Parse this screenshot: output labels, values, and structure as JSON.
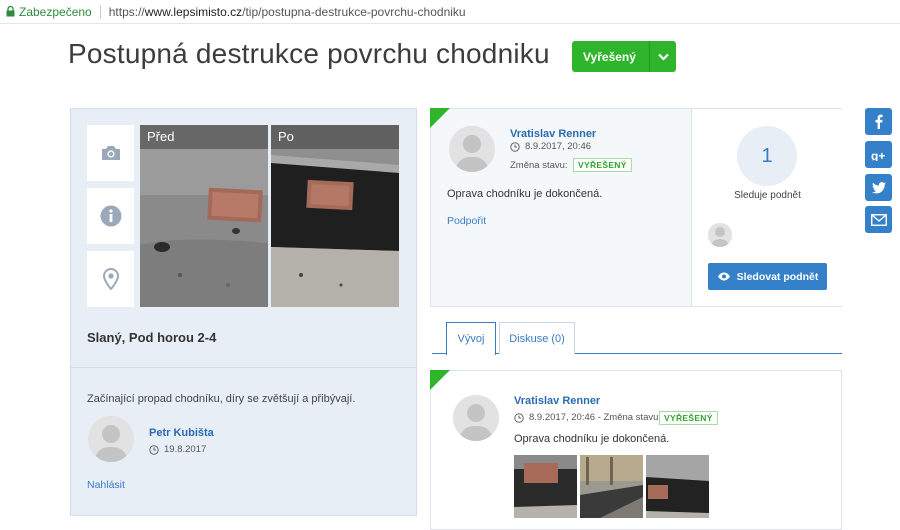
{
  "browser": {
    "secure_label": "Zabezpečeno",
    "url_prefix": "https://",
    "url_host": "www.lepsimisto.cz",
    "url_path": "/tip/postupna-destrukce-povrchu-chodniku"
  },
  "page": {
    "title": "Postupná destrukce povrchu chodniku",
    "status_label": "Vyřešený"
  },
  "left": {
    "photo_before_label": "Před",
    "photo_after_label": "Po",
    "location": "Slaný, Pod horou 2-4",
    "description": "Začínající propad chodníku, díry se zvětšují a přibývají.",
    "author_name": "Petr Kubišta",
    "author_date": "19.8.2017",
    "report_link": "Nahlásit"
  },
  "update": {
    "author_name": "Vratislav Renner",
    "date": "8.9.2017, 20:46",
    "change_label": "Změna stavu:",
    "status_badge": "VYŘEŠENÝ",
    "text": "Oprava chodníku je dokončená.",
    "support_link": "Podpořit"
  },
  "follow": {
    "count": "1",
    "label": "Sleduje podnět",
    "button_label": "Sledovat podnět"
  },
  "tabs": {
    "vyvoj": "Vývoj",
    "diskuse": "Diskuse (0)"
  },
  "timeline": {
    "author_name": "Vratislav Renner",
    "date_line": "8.9.2017, 20:46 - Změna stavu:",
    "status_badge": "VYŘEŠENÝ",
    "text": "Oprava chodníku je dokončená."
  },
  "social": [
    "facebook-icon",
    "google-plus-icon",
    "twitter-icon",
    "email-icon"
  ],
  "colors": {
    "accent_green": "#2fb52c",
    "accent_blue": "#3480c9",
    "panel_bg": "#e8eef6"
  }
}
